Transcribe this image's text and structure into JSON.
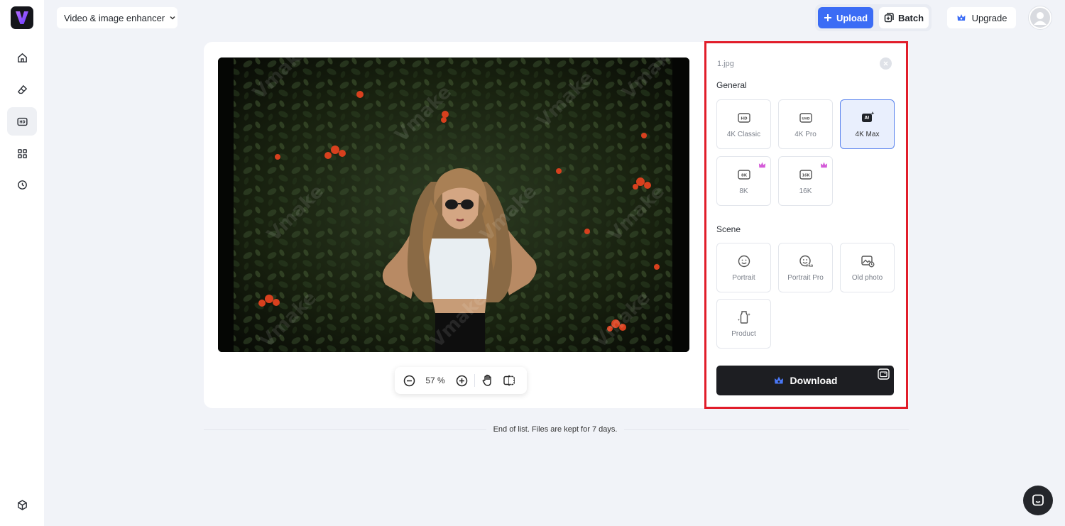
{
  "topbar": {
    "tool_select": "Video & image enhancer",
    "upload": "Upload",
    "batch": "Batch",
    "upgrade": "Upgrade"
  },
  "sidebar": {
    "items": [
      {
        "icon": "home-icon"
      },
      {
        "icon": "eraser-icon"
      },
      {
        "icon": "hd-icon",
        "active": true
      },
      {
        "icon": "apps-grid-icon"
      },
      {
        "icon": "history-clock-icon"
      }
    ],
    "bottom_icon": "box-icon"
  },
  "preview": {
    "watermark": "Vmake",
    "zoom": "57 %"
  },
  "panel": {
    "file_name": "1.jpg",
    "general_label": "General",
    "general_options": [
      {
        "label": "4K Classic",
        "icon": "hd-icon",
        "premium": false,
        "selected": false
      },
      {
        "label": "4K Pro",
        "icon": "uhd-icon",
        "premium": false,
        "selected": false
      },
      {
        "label": "4K Max",
        "icon": "ai-ultra-icon",
        "premium": false,
        "selected": true
      },
      {
        "label": "8K",
        "icon": "8k-icon",
        "premium": true,
        "selected": false
      },
      {
        "label": "16K",
        "icon": "16k-icon",
        "premium": true,
        "selected": false
      }
    ],
    "scene_label": "Scene",
    "scene_options": [
      {
        "label": "Portrait",
        "icon": "smile-icon"
      },
      {
        "label": "Portrait Pro",
        "icon": "smile-pro-icon"
      },
      {
        "label": "Old photo",
        "icon": "old-photo-icon"
      },
      {
        "label": "Product",
        "icon": "product-icon"
      }
    ],
    "download": "Download"
  },
  "footer": {
    "end_text": "End of list. Files are kept for 7 days."
  },
  "colors": {
    "accent": "#3b6cf5",
    "selected_bg": "#e9effd",
    "premium": "#d45bd8",
    "highlight_frame": "#e11d2a"
  }
}
